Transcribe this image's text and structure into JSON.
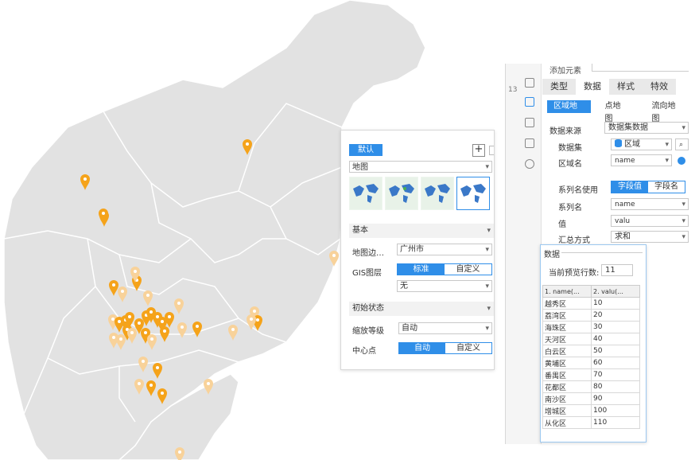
{
  "map_panel": {
    "style_tag": "默认",
    "map_select": "地图",
    "basic_section": "基本",
    "boundary_label": "地图边…",
    "boundary_value": "广州市",
    "gis_label": "GIS图层",
    "gis_options": [
      "标准",
      "自定义"
    ],
    "gis_layer_value": "无",
    "initial_section": "初始状态",
    "zoom_label": "缩放等级",
    "zoom_value": "自动",
    "center_label": "中心点",
    "center_options": [
      "自动",
      "自定义"
    ]
  },
  "right_panel": {
    "top_label": "添加元素",
    "tabs": [
      "类型",
      "数据",
      "样式",
      "特效"
    ],
    "subtabs": [
      "区域地图",
      "点地图",
      "流向地图"
    ],
    "data_source_label": "数据来源",
    "data_source_value": "数据集数据",
    "dataset_label": "数据集",
    "dataset_value": "区域",
    "area_name_label": "区域名",
    "area_name_value": "name",
    "series_use_label": "系列名使用",
    "series_use_options": [
      "字段值",
      "字段名"
    ],
    "series_name_label": "系列名",
    "series_name_value": "name",
    "value_label": "值",
    "value_value": "valu",
    "summary_label": "汇总方式",
    "summary_value": "求和",
    "side_number": "13"
  },
  "data_popup": {
    "title": "数据",
    "preview_rows_label": "当前预览行数:",
    "preview_rows_value": "11",
    "columns": [
      "1. name(...",
      "2. valu(..."
    ],
    "rows": [
      [
        "越秀区",
        "10"
      ],
      [
        "荔湾区",
        "20"
      ],
      [
        "海珠区",
        "30"
      ],
      [
        "天河区",
        "40"
      ],
      [
        "白云区",
        "50"
      ],
      [
        "黄埔区",
        "60"
      ],
      [
        "番禺区",
        "70"
      ],
      [
        "花都区",
        "80"
      ],
      [
        "南沙区",
        "90"
      ],
      [
        "增城区",
        "100"
      ],
      [
        "从化区",
        "110"
      ]
    ]
  },
  "colors": {
    "accent": "#2f8ee8",
    "map_fill": "#e2e2e2",
    "pin": "#f5a31a",
    "pin_faded": "#f8d29a"
  }
}
